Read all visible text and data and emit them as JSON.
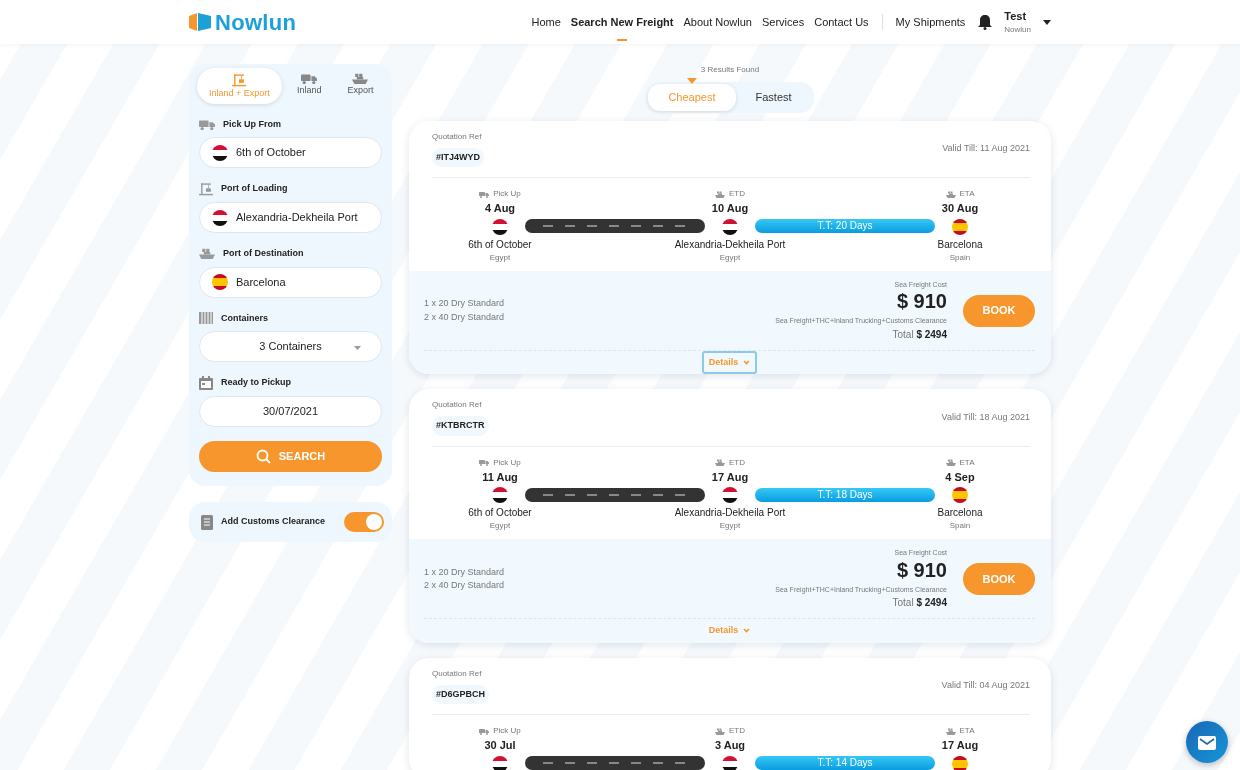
{
  "navbar": {
    "logo": "Nowlun",
    "links": [
      {
        "label": "Home",
        "selected": false
      },
      {
        "label": "Search New Freight",
        "selected": true
      },
      {
        "label": "About Nowlun",
        "selected": false
      },
      {
        "label": "Services",
        "selected": false
      },
      {
        "label": "Contact Us",
        "selected": false
      }
    ],
    "my_shipments": "My Shipments",
    "user": {
      "name": "Test",
      "company": "Nowlun"
    }
  },
  "sidebar": {
    "modes": [
      {
        "label": "Inland + Export",
        "selected": true
      },
      {
        "label": "Inland",
        "selected": false
      },
      {
        "label": "Export",
        "selected": false
      }
    ],
    "fields": [
      {
        "kind": "location",
        "label": "Pick Up From",
        "value": "6th of October",
        "flag": {
          "kind": "egypt"
        }
      },
      {
        "kind": "location",
        "label": "Port of Loading",
        "value": "Alexandria-Dekheila Port",
        "flag": {
          "kind": "egypt"
        }
      },
      {
        "kind": "location",
        "label": "Port of Destination",
        "value": "Barcelona",
        "flag": {
          "kind": "spain"
        }
      },
      {
        "kind": "select",
        "label": "Containers",
        "value": "3 Containers"
      },
      {
        "kind": "date",
        "label": "Ready to Pickup",
        "value": "30/07/2021"
      }
    ],
    "search_button": "SEARCH",
    "customs": {
      "label": "Add Customs Clearance",
      "on": true
    }
  },
  "results": {
    "count": "3 Results Found",
    "sort_tabs": [
      {
        "label": "Cheapest",
        "selected": true
      },
      {
        "label": "Fastest",
        "selected": false
      }
    ],
    "quotes": [
      {
        "ref_label": "Quotation Ref",
        "ref": "#ITJ4WYD",
        "valid_till": "Valid Till: 11 Aug 2021",
        "stops": [
          {
            "kind": "pickup",
            "label": "Pick Up",
            "date": "4 Aug",
            "flag": {
              "kind": "egypt"
            },
            "place": "6th of October",
            "country": "Egypt"
          },
          {
            "kind": "departure",
            "label": "ETD",
            "date": "10 Aug",
            "flag": {
              "kind": "egypt"
            },
            "place": "Alexandria-Dekheila Port",
            "country": "Egypt"
          },
          {
            "kind": "arrival",
            "label": "ETA",
            "date": "30 Aug",
            "flag": {
              "kind": "spain"
            },
            "place": "Barcelona",
            "country": "Spain"
          }
        ],
        "transit": "T.T: 20 Days",
        "containers": [
          "1 x 20 Dry Standard",
          "2 x 40 Dry Standard"
        ],
        "cost_label": "Sea Freight Cost",
        "price": "$ 910",
        "includes": "Sea Freight+THC+Inland Trucking+Customs Clearance",
        "total_label": "Total",
        "total": "$ 2494",
        "book": "BOOK",
        "details": "Details",
        "details_focused": true
      },
      {
        "ref_label": "Quotation Ref",
        "ref": "#KTBRCTR",
        "valid_till": "Valid Till: 18 Aug 2021",
        "stops": [
          {
            "kind": "pickup",
            "label": "Pick Up",
            "date": "11 Aug",
            "flag": {
              "kind": "egypt"
            },
            "place": "6th of October",
            "country": "Egypt"
          },
          {
            "kind": "departure",
            "label": "ETD",
            "date": "17 Aug",
            "flag": {
              "kind": "egypt"
            },
            "place": "Alexandria-Dekheila Port",
            "country": "Egypt"
          },
          {
            "kind": "arrival",
            "label": "ETA",
            "date": "4 Sep",
            "flag": {
              "kind": "spain"
            },
            "place": "Barcelona",
            "country": "Spain"
          }
        ],
        "transit": "T.T: 18 Days",
        "containers": [
          "1 x 20 Dry Standard",
          "2 x 40 Dry Standard"
        ],
        "cost_label": "Sea Freight Cost",
        "price": "$ 910",
        "includes": "Sea Freight+THC+Inland Trucking+Customs Clearance",
        "total_label": "Total",
        "total": "$ 2494",
        "book": "BOOK",
        "details": "Details",
        "details_focused": false
      },
      {
        "ref_label": "Quotation Ref",
        "ref": "#D6GPBCH",
        "valid_till": "Valid Till: 04 Aug 2021",
        "stops": [
          {
            "kind": "pickup",
            "label": "Pick Up",
            "date": "30 Jul",
            "flag": {
              "kind": "egypt"
            }
          },
          {
            "kind": "departure",
            "label": "ETD",
            "date": "3 Aug",
            "flag": {
              "kind": "egypt"
            }
          },
          {
            "kind": "arrival",
            "label": "ETA",
            "date": "17 Aug",
            "flag": {
              "kind": "spain"
            }
          }
        ],
        "transit": "T.T: 14 Days"
      }
    ]
  }
}
